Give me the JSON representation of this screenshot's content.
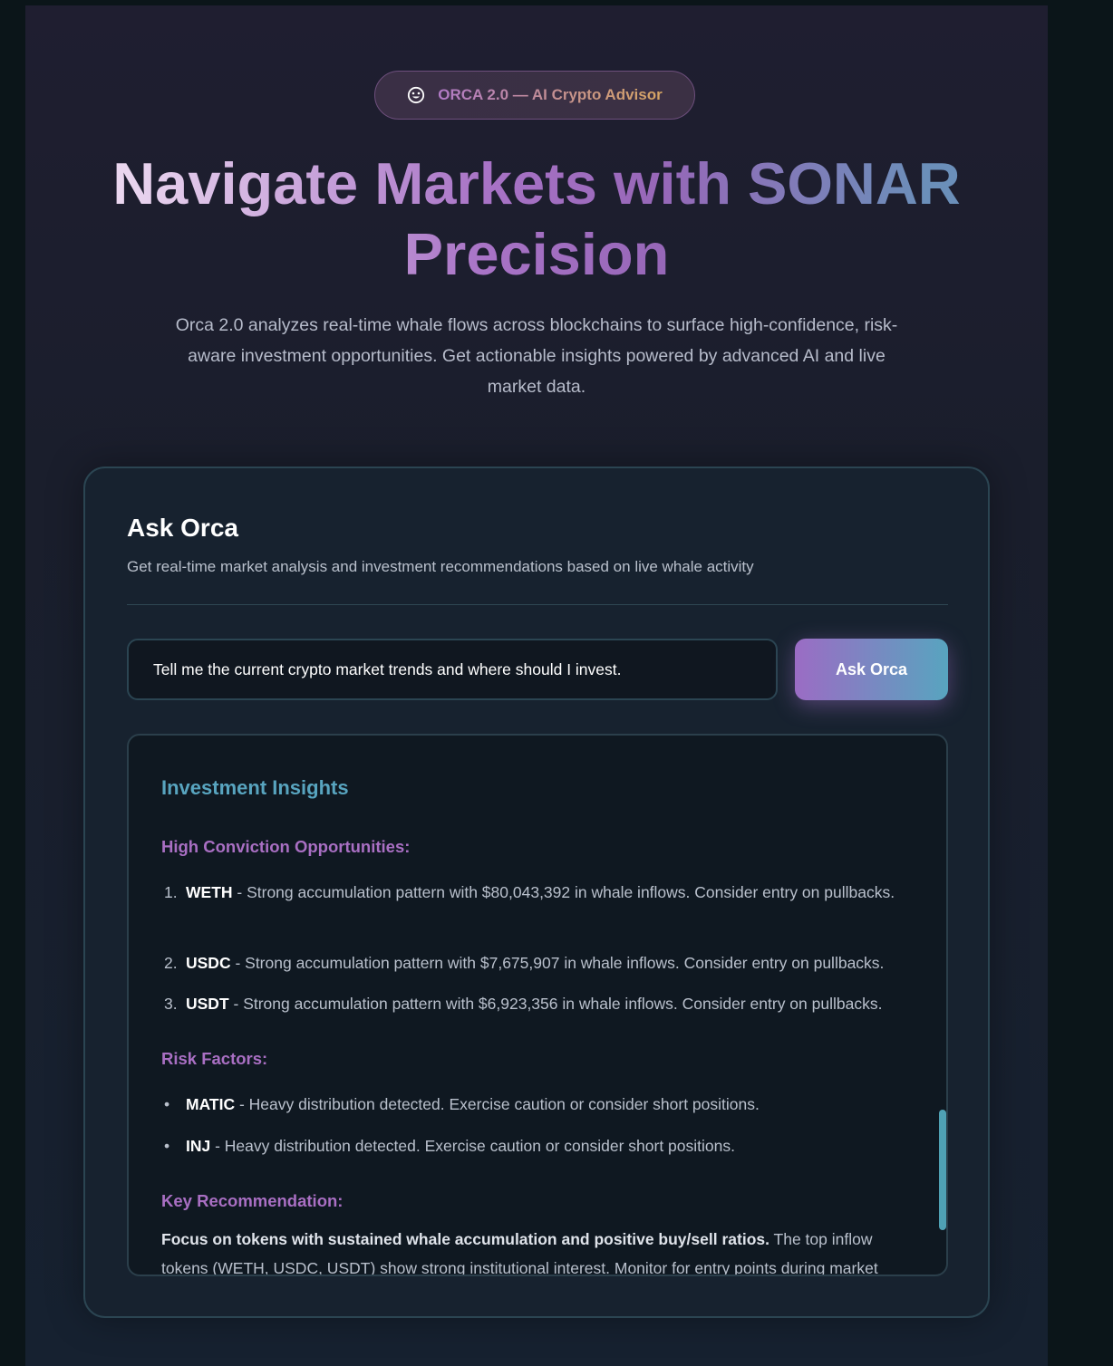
{
  "badge": {
    "icon": "smiley-icon",
    "text": "ORCA 2.0 — AI Crypto Advisor"
  },
  "hero": {
    "title_line1": "Navigate Markets with SONAR",
    "title_line2": "Precision",
    "subtitle": "Orca 2.0 analyzes real-time whale flows across blockchains to surface high-confidence, risk-aware investment opportunities. Get actionable insights powered by advanced AI and live market data."
  },
  "ask_card": {
    "title": "Ask Orca",
    "subtitle": "Get real-time market analysis and investment recommendations based on live whale activity",
    "input_value": "Tell me the current crypto market trends and where should I invest.",
    "button_label": "Ask Orca"
  },
  "insights": {
    "title": "Investment Insights",
    "high_conviction": {
      "heading": "High Conviction Opportunities:",
      "items": [
        {
          "marker": "1.",
          "token": "WETH",
          "text": " - Strong accumulation pattern with $80,043,392 in whale inflows. Consider entry on pullbacks."
        },
        {
          "marker": "2.",
          "token": "USDC",
          "text": " - Strong accumulation pattern with $7,675,907 in whale inflows. Consider entry on pullbacks."
        },
        {
          "marker": "3.",
          "token": "USDT",
          "text": " - Strong accumulation pattern with $6,923,356 in whale inflows. Consider entry on pullbacks."
        }
      ]
    },
    "risk_factors": {
      "heading": "Risk Factors:",
      "items": [
        {
          "marker": "•",
          "token": "MATIC",
          "text": " - Heavy distribution detected. Exercise caution or consider short positions."
        },
        {
          "marker": "•",
          "token": "INJ",
          "text": " - Heavy distribution detected. Exercise caution or consider short positions."
        }
      ]
    },
    "key_recommendation": {
      "heading": "Key Recommendation:",
      "strong": "Focus on tokens with sustained whale accumulation and positive buy/sell ratios.",
      "text": " The top inflow tokens (WETH, USDC, USDT) show strong institutional interest. Monitor for entry points during market"
    }
  },
  "colors": {
    "accent_purple": "#a96fc3",
    "accent_teal": "#58a4bf",
    "card_border": "#2b4552"
  }
}
